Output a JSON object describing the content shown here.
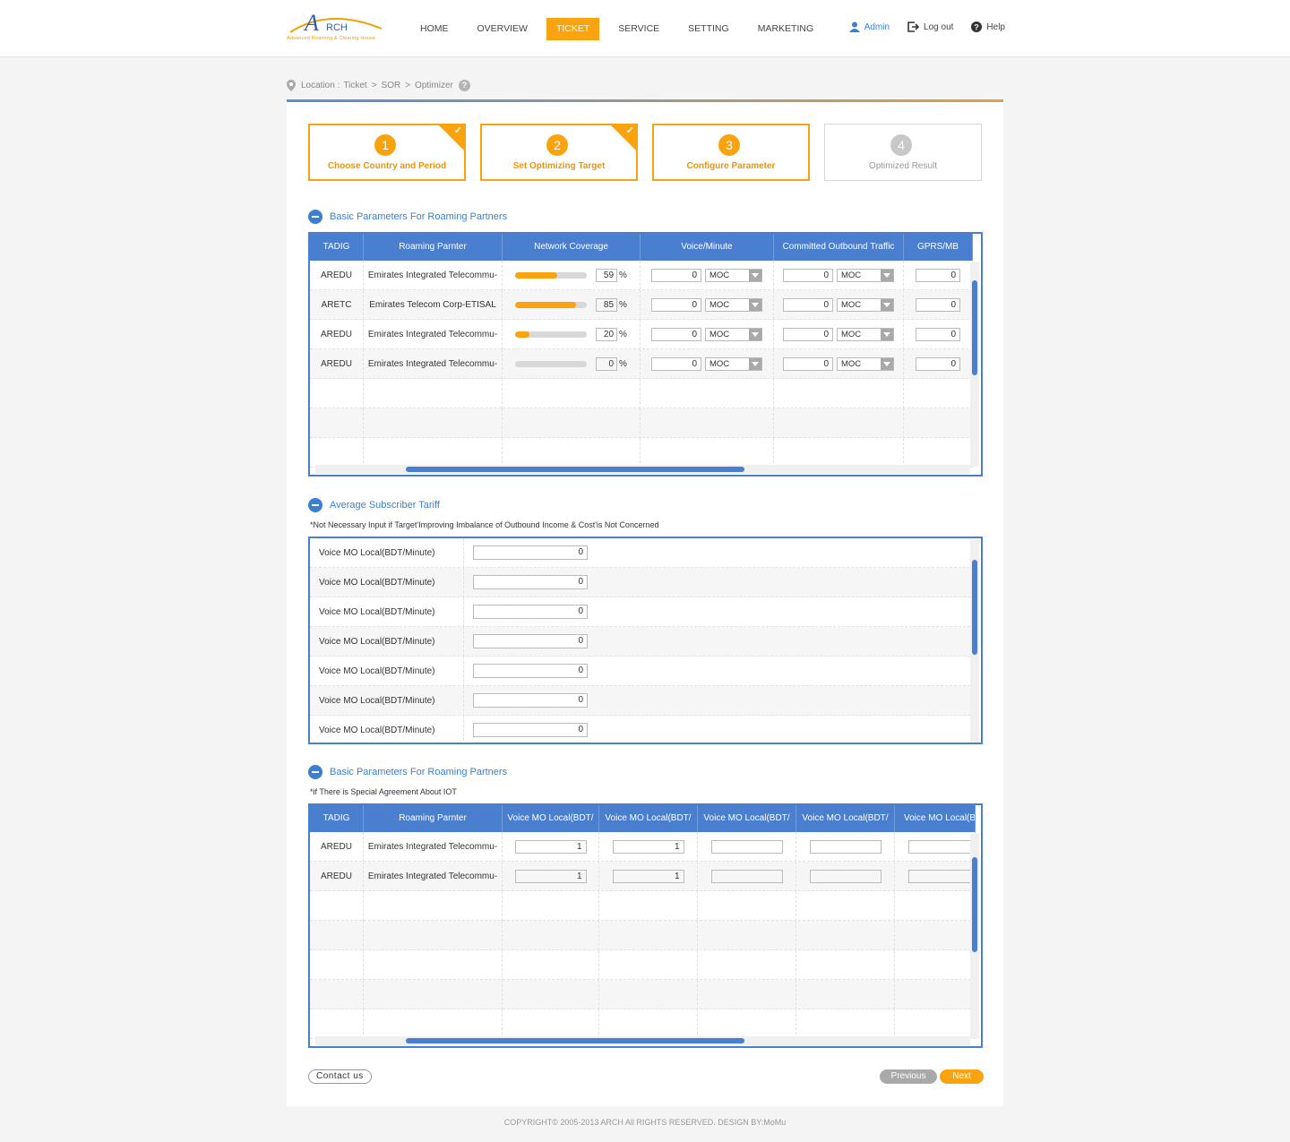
{
  "logo": {
    "text": "RCH",
    "letter": "A",
    "tagline": "Advanced Roaming & Clearing House"
  },
  "nav": {
    "items": [
      {
        "label": "HOME",
        "active": false
      },
      {
        "label": "OVERVIEW",
        "active": false
      },
      {
        "label": "TICKET",
        "active": true
      },
      {
        "label": "SERVICE",
        "active": false
      },
      {
        "label": "SETTING",
        "active": false
      },
      {
        "label": "MARKETING",
        "active": false
      }
    ]
  },
  "user": {
    "admin": "Admin",
    "logout": "Log out",
    "help": "Help"
  },
  "breadcrumb": {
    "location": "Location :",
    "items": [
      "Ticket",
      "SOR",
      "Optimizer"
    ],
    "separator": ">",
    "help": "?"
  },
  "steps": [
    {
      "num": "1",
      "label": "Choose Country and Period",
      "done": true
    },
    {
      "num": "2",
      "label": "Set Optimizing Target",
      "done": true
    },
    {
      "num": "3",
      "label": "Configure Parameter",
      "done": false
    },
    {
      "num": "4",
      "label": "Optimized Result",
      "done": false
    }
  ],
  "section1": {
    "title": "Basic Parameters For Roaming Partners",
    "columns": [
      "TADIG",
      "Roaming Parnter",
      "Network Coverage",
      "Voice/Minute",
      "Committed Outbound Traffic",
      "GPRS/MB"
    ],
    "rows": [
      {
        "tadig": "AREDU",
        "partner": "Emirates Integrated Telecommu-",
        "coverage": 59,
        "coverage_text": "59",
        "voice": "0",
        "voice_type": "MOC",
        "committed": "0",
        "committed_type": "MOC",
        "gprs": "0"
      },
      {
        "tadig": "ARETC",
        "partner": "Emirates Telecom Corp-ETISAL",
        "coverage": 85,
        "coverage_text": "85",
        "voice": "0",
        "voice_type": "MOC",
        "committed": "0",
        "committed_type": "MOC",
        "gprs": "0"
      },
      {
        "tadig": "AREDU",
        "partner": "Emirates Integrated Telecommu-",
        "coverage": 20,
        "coverage_text": "20",
        "voice": "0",
        "voice_type": "MOC",
        "committed": "0",
        "committed_type": "MOC",
        "gprs": "0"
      },
      {
        "tadig": "AREDU",
        "partner": "Emirates Integrated Telecommu-",
        "coverage": 0,
        "coverage_text": "0",
        "voice": "0",
        "voice_type": "MOC",
        "committed": "0",
        "committed_type": "MOC",
        "gprs": "0"
      }
    ],
    "percent_sign": "%"
  },
  "section2": {
    "title": "Average Subscriber Tariff",
    "note": "*Not Necessary Input if Target'Improving Imbalance of Outbound Income & Cost'is Not Concerned",
    "rows": [
      {
        "label": "Voice MO Local(BDT/Minute)",
        "value": "0"
      },
      {
        "label": "Voice MO Local(BDT/Minute)",
        "value": "0"
      },
      {
        "label": "Voice MO Local(BDT/Minute)",
        "value": "0"
      },
      {
        "label": "Voice MO Local(BDT/Minute)",
        "value": "0"
      },
      {
        "label": "Voice MO Local(BDT/Minute)",
        "value": "0"
      },
      {
        "label": "Voice MO Local(BDT/Minute)",
        "value": "0"
      },
      {
        "label": "Voice MO Local(BDT/Minute)",
        "value": "0"
      }
    ]
  },
  "section3": {
    "title": "Basic Parameters For Roaming Partners",
    "note": "*if There is Special Agreement About IOT",
    "columns": [
      "TADIG",
      "Roaming Parnter",
      "Voice MO Local(BDT/",
      "Voice MO Local(BDT/",
      "Voice MO Local(BDT/",
      "Voice MO Local(BDT/",
      "Voice MO Local(BD"
    ],
    "rows": [
      {
        "tadig": "AREDU",
        "partner": "Emirates Integrated Telecommu-",
        "v1": "1",
        "v2": "1",
        "v3": "",
        "v4": "",
        "v5": ""
      },
      {
        "tadig": "AREDU",
        "partner": "Emirates Integrated Telecommu-",
        "v1": "1",
        "v2": "1",
        "v3": "",
        "v4": "",
        "v5": ""
      }
    ]
  },
  "buttons": {
    "contact": "Contact us",
    "previous": "Previous",
    "next": "Next"
  },
  "footer": "COPYRIGHT© 2005-2013 ARCH All RIGHTS RESERVED. DESIGN BY:MoMu",
  "colors": {
    "accent": "#f9a30f",
    "primary": "#4a7fd0"
  }
}
